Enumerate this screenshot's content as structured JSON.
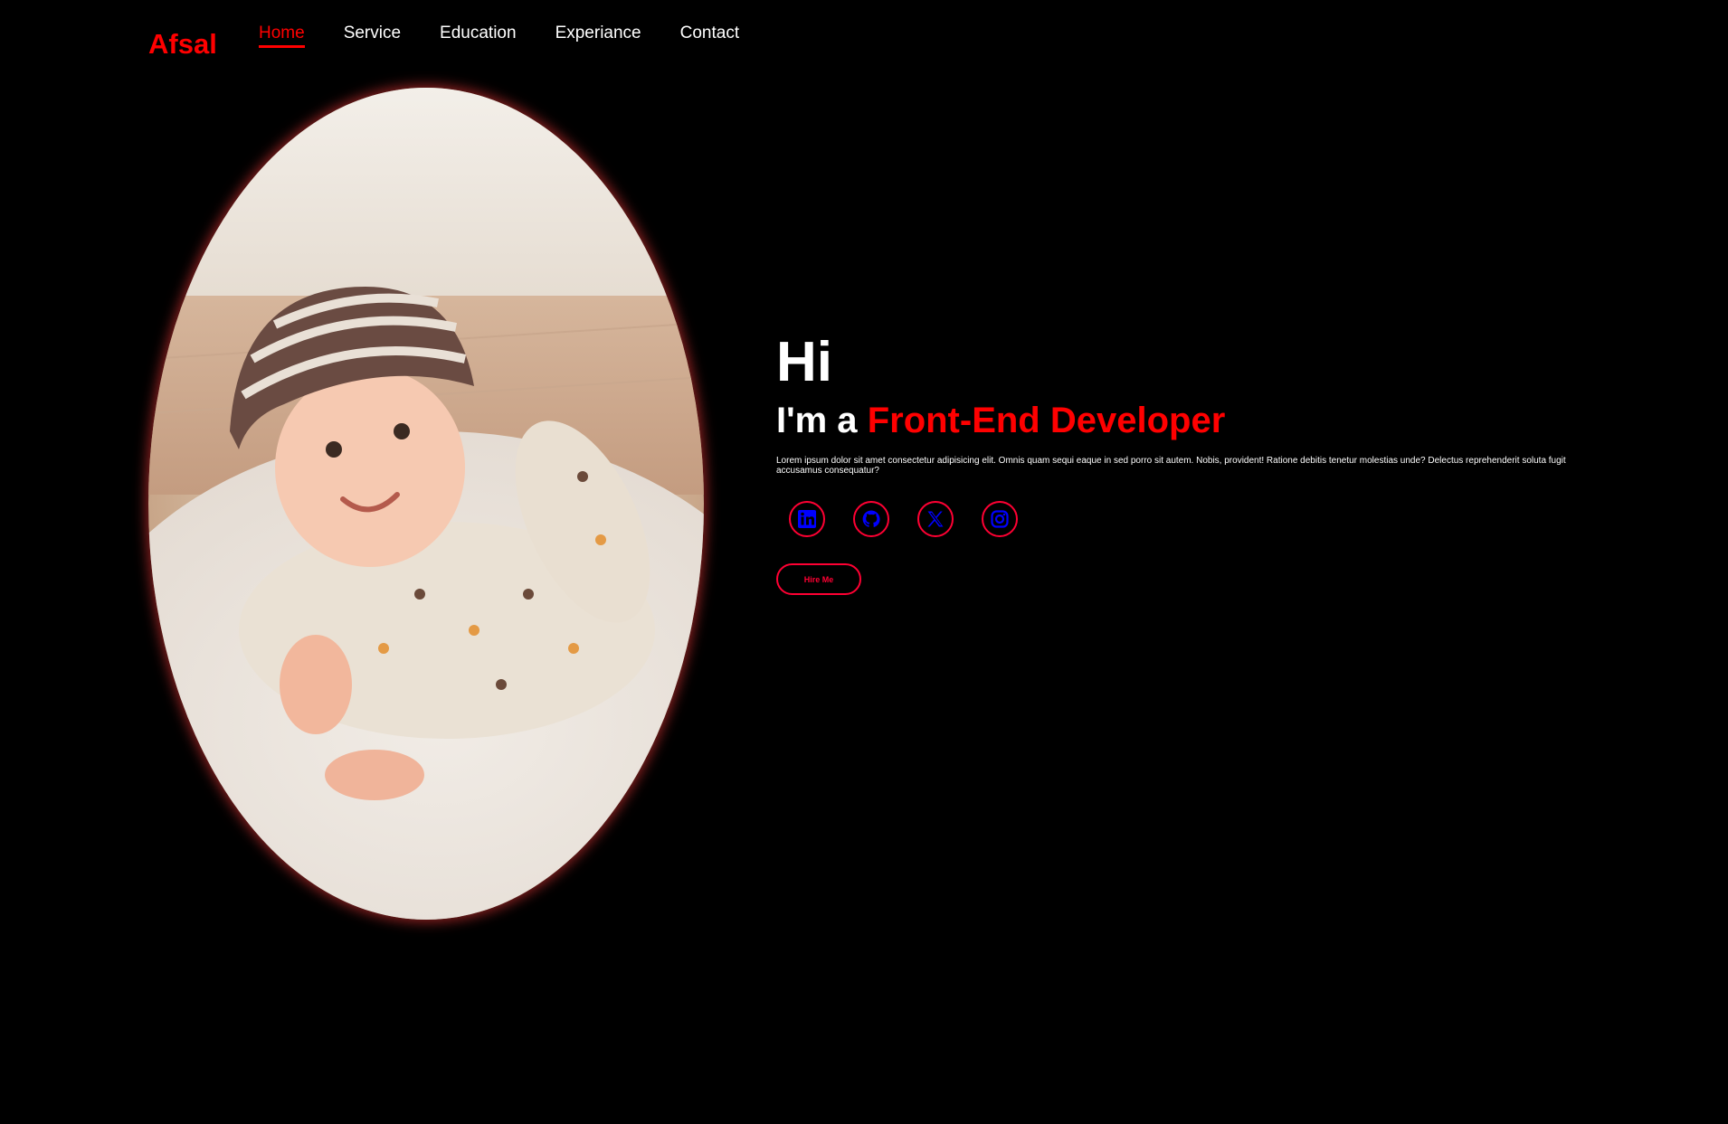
{
  "header": {
    "logo": "Afsal",
    "nav": [
      {
        "label": "Home",
        "active": true
      },
      {
        "label": "Service",
        "active": false
      },
      {
        "label": "Education",
        "active": false
      },
      {
        "label": "Experiance",
        "active": false
      },
      {
        "label": "Contact",
        "active": false
      }
    ]
  },
  "hero": {
    "greeting": "Hi",
    "role_prefix": "I'm a",
    "role_highlight": "Front-End Developer",
    "description": "Lorem ipsum dolor sit amet consectetur adipisicing elit. Omnis quam sequi eaque in sed porro sit autem. Nobis, provident! Ratione debitis tenetur molestias unde? Delectus reprehenderit soluta fugit accusamus consequatur?",
    "socials": [
      {
        "icon": "linkedin-icon"
      },
      {
        "icon": "github-icon"
      },
      {
        "icon": "x-icon"
      },
      {
        "icon": "instagram-icon"
      }
    ],
    "hire_label": "Hire Me"
  },
  "colors": {
    "background": "#000000",
    "accent": "#ff0000",
    "icon": "#0000ff",
    "text": "#ffffff"
  }
}
